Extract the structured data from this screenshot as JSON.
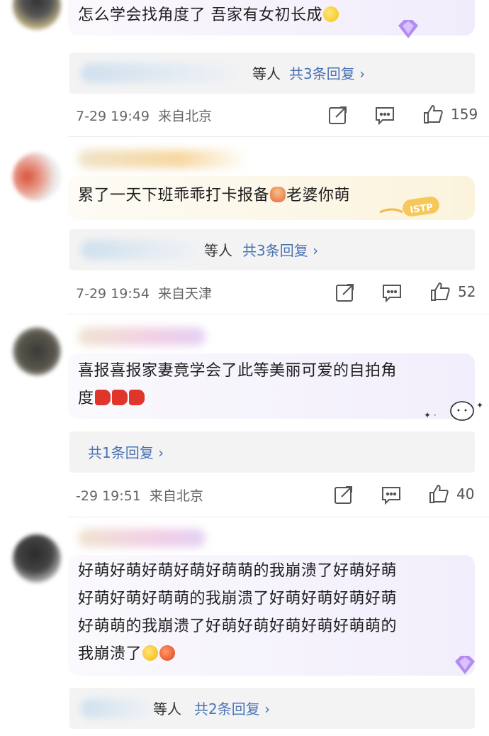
{
  "comments": [
    {
      "text": "怎么学会找角度了 吾家有女初长成",
      "emoji": "crying-face",
      "reply_suffix": "等人",
      "reply_link": "共3条回复 ›",
      "time": "7-29 19:49",
      "location": "来自北京",
      "likes": "159"
    },
    {
      "text": "累了一天下班乖乖打卡报备",
      "emoji": "person-hug",
      "text2": "老婆你萌",
      "reply_suffix": "等人",
      "reply_link": "共3条回复 ›",
      "time": "7-29 19:54",
      "location": "来自天津",
      "likes": "52"
    },
    {
      "text": "喜报喜报家妻竟学会了此等美丽可爱的自拍角",
      "text_line2": "度",
      "emoji": "megaphone",
      "reply_link": "共1条回复 ›",
      "time": "-29 19:51",
      "location": "来自北京",
      "likes": "40"
    },
    {
      "lines": [
        "好萌好萌好萌好萌好萌萌的我崩溃了好萌好萌",
        "好萌好萌好萌萌的我崩溃了好萌好萌好萌好萌",
        "好萌萌的我崩溃了好萌好萌好萌好萌好萌萌的",
        "我崩溃了"
      ],
      "emojis": [
        "tired-face",
        "angry-face"
      ],
      "reply_suffix": "等人",
      "reply_link": "共2条回复 ›"
    }
  ],
  "icons": {
    "share": "share-icon",
    "comment": "comment-icon",
    "like": "thumbs-up-icon",
    "badge": "diamond-badge-icon"
  },
  "colors": {
    "link": "#4a73b3",
    "bubble_purple": "#f2eefb",
    "bubble_yellow": "#fbf3dc",
    "reply_bg": "#f3f3f3"
  }
}
